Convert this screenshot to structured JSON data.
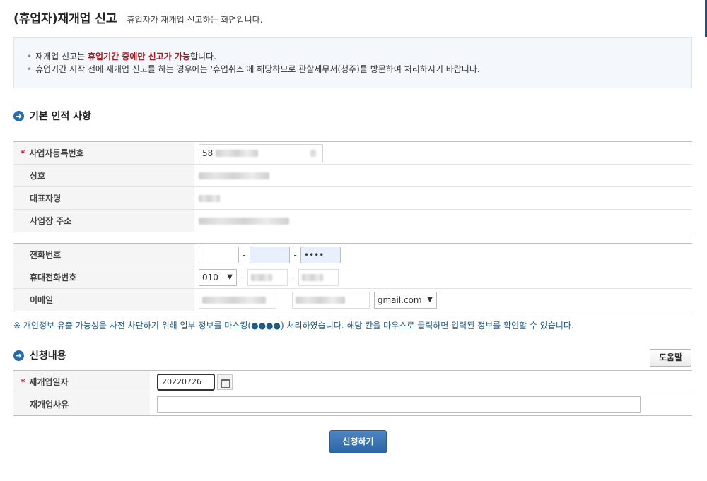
{
  "header": {
    "title": "(휴업자)재개업 신고",
    "description": "휴업자가 재개업 신고하는 화면입니다."
  },
  "notice": {
    "line1_prefix": "재개업 신고는 ",
    "line1_emphasis": "휴업기간 중에만 신고가 가능",
    "line1_suffix": "합니다.",
    "line2": "휴업기간 시작 전에 재개업 신고를 하는 경우에는 '휴업취소'에 해당하므로 관할세무서(청주)를 방문하여 처리하시기 바랍니다."
  },
  "basic_info": {
    "section_title": "기본 인적 사항",
    "business_number_label": "사업자등록번호",
    "business_number_prefix": "58",
    "company_name_label": "상호",
    "representative_label": "대표자명",
    "address_label": "사업장 주소"
  },
  "contact": {
    "phone_label": "전화번호",
    "phone_part3": "••••",
    "mobile_label": "휴대전화번호",
    "mobile_prefix": "010",
    "email_label": "이메일",
    "email_domain": "gmail.com"
  },
  "privacy_note": "※ 개인정보 유출 가능성을 사전 차단하기 위해 일부 정보를 마스킹(●●●●) 처리하였습니다. 해당 칸을 마우스로 클릭하면 입력된 정보를 확인할 수 있습니다.",
  "application": {
    "section_title": "신청내용",
    "help_label": "도움말",
    "reopen_date_label": "재개업일자",
    "reopen_date_value": "20220726",
    "reopen_reason_label": "재개업사유"
  },
  "submit_label": "신청하기"
}
